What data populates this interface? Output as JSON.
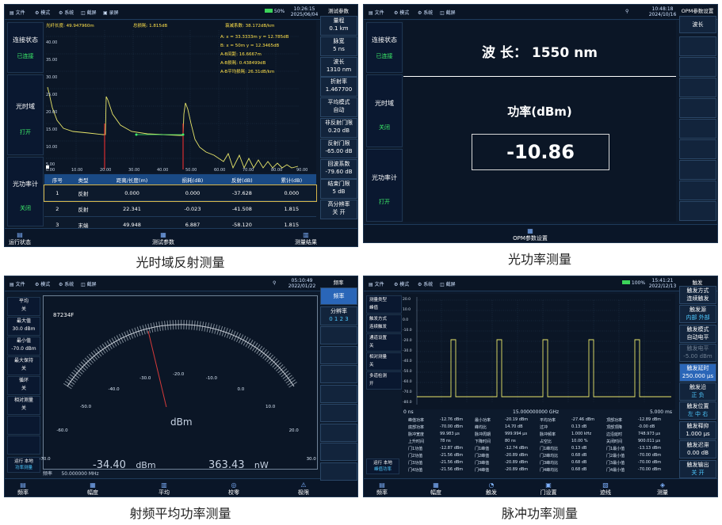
{
  "menu": {
    "file": "文件",
    "mode": "模式",
    "system": "系统",
    "screenshot": "截屏",
    "record": "录屏"
  },
  "otdr": {
    "battery": "50%",
    "time": "10:26:15",
    "date": "2025/06/04",
    "left": {
      "conn_label": "连接状态",
      "conn_value": "已连接",
      "otdr_label": "光时域",
      "otdr_value": "打开",
      "opm_label": "光功率计",
      "opm_value": "关闭"
    },
    "header": {
      "fiber_length": "光纤长度: 49.947960m",
      "total_loss": "总损耗: 1.815dB",
      "attenuation": "衰减系数: 38.172dB/km"
    },
    "markers": [
      "A:  x = 33.3333m    y = 12.785dB",
      "B:  x = 50m      y = 12.3465dB",
      "A-B间距:     16.6667m",
      "A-B损耗:     0.438499dB",
      "A-B平均损耗:    26.31dB/km"
    ],
    "y_ticks": [
      "40.00",
      "35.00",
      "30.00",
      "25.00",
      "20.00",
      "15.00",
      "10.00",
      "5.00",
      "0.00"
    ],
    "x_ticks": [
      "0.00",
      "10.00",
      "20.00",
      "30.00",
      "40.00",
      "50.00",
      "60.00",
      "70.00",
      "80.00",
      "90.00"
    ],
    "table": {
      "headers": [
        "序号",
        "类型",
        "距离/长度(m)",
        "损耗(dB)",
        "反射(dB)",
        "累计(dB)"
      ],
      "rows": [
        [
          "1",
          "反射",
          "0.000",
          "0.000",
          "-37.628",
          "0.000"
        ],
        [
          "2",
          "反射",
          "22.341",
          "-0.023",
          "-41.508",
          "1.815"
        ],
        [
          "3",
          "末端",
          "49.948",
          "6.887",
          "-58.120",
          "1.815"
        ]
      ]
    },
    "right_title": "测试参数",
    "params": [
      {
        "label": "量程",
        "value": "0.1 km"
      },
      {
        "label": "脉宽",
        "value": "5 ns"
      },
      {
        "label": "波长",
        "value": "1310 nm"
      },
      {
        "label": "折射率",
        "value": "1.467700"
      },
      {
        "label": "平均模式",
        "value": "自动"
      },
      {
        "label": "非反射门限",
        "value": "0.20 dB"
      },
      {
        "label": "反射门限",
        "value": "-65.00 dB"
      },
      {
        "label": "回波系数",
        "value": "-79.60 dB"
      },
      {
        "label": "结束门限",
        "value": "5 dB"
      },
      {
        "label": "高分辨率",
        "value": "关    开"
      }
    ],
    "bottom": [
      "运行状态",
      "测试参数",
      "测量结果"
    ]
  },
  "opm": {
    "time": "10:48:18",
    "date": "2024/10/16",
    "right_title": "OPM参数设置",
    "right_btn": "波长",
    "left": {
      "conn_label": "连接状态",
      "conn_value": "已连接",
      "otdr_label": "光时域",
      "otdr_value": "关闭",
      "opm_label": "光功率计",
      "opm_value": "打开"
    },
    "wavelength": "波 长：   1550 nm",
    "power_label": "功率(dBm)",
    "power_value": "-10.86",
    "bottom": "OPM参数设置"
  },
  "rf": {
    "time": "05:10:49",
    "date": "2022/01/22",
    "right_title": "频率",
    "right_btn1": "频率",
    "res_label": "分辨率",
    "res_values": "0  1  2  3",
    "left": [
      {
        "label": "平均",
        "value": "关"
      },
      {
        "label": "最大值",
        "value": "30.0 dBm"
      },
      {
        "label": "最小值",
        "value": "-70.0 dBm"
      },
      {
        "label": "最大保持",
        "value": "关"
      },
      {
        "label": "循环",
        "value": "关"
      },
      {
        "label": "相对测量",
        "value": "关"
      }
    ],
    "status": "运行 本地",
    "status2": "功率测量",
    "model": "87234F",
    "scale": [
      "-70.0",
      "-60.0",
      "-50.0",
      "-40.0",
      "-30.0",
      "-20.0",
      "-10.0",
      "0.0",
      "10.0",
      "20.0",
      "30.0"
    ],
    "unit": "dBm",
    "reading1": "-34.40",
    "unit1": "dBm",
    "reading2": "363.43",
    "unit2": "nW",
    "freq_label": "频率",
    "freq_value": "50.000000 MHz",
    "bottom": [
      "频率",
      "幅度",
      "平均",
      "校零",
      "极限"
    ]
  },
  "pulse": {
    "battery": "100%",
    "time": "15:41:21",
    "date": "2022/12/13",
    "right_title": "触发",
    "left": [
      {
        "label": "测量类型",
        "value": "峰值"
      },
      {
        "label": "触发方式",
        "value": "连续触发"
      },
      {
        "label": "通道设置",
        "value": "关"
      },
      {
        "label": "相对测量",
        "value": "关"
      },
      {
        "label": "多道检测",
        "value": "开"
      }
    ],
    "status": "运行 本地",
    "status2": "峰值功率",
    "y_ticks": [
      "20.0",
      "10.0",
      "0.0",
      "-10.0",
      "-20.0",
      "-30.0",
      "-40.0",
      "-50.0",
      "-60.0",
      "-70.0",
      "-80.0"
    ],
    "x_left": "0 ns",
    "x_center": "15.000000000 GHz",
    "x_right": "5.000 ms",
    "table": [
      [
        "峰值功率",
        "-12.76 dBm",
        "最小功率",
        "-20.19 dBm",
        "平均功率",
        "-27.46 dBm",
        "顶部功率",
        "-12.89 dBm"
      ],
      [
        "底部功率",
        "-70.00 dBm",
        "峰均比",
        "14.70 dB",
        "过冲",
        "0.13 dB",
        "顶部顶降",
        "-0.00 dB"
      ],
      [
        "脉冲宽度",
        "99.983 μs",
        "脉冲周期",
        "999.994 μs",
        "脉冲频率",
        "1.000 kHz",
        "边沿延时",
        "748.973 μs"
      ],
      [
        "上升时间",
        "78 ns",
        "下降时间",
        "80 ns",
        "占空比",
        "10.00 %",
        "关闭时间",
        "900.011 μs"
      ],
      [
        "门1功值",
        "-12.87 dBm",
        "门1峰值",
        "-12.74 dBm",
        "门1峰均比",
        "0.13 dB",
        "门1最小值",
        "-13.13 dBm"
      ],
      [
        "门2功值",
        "-21.56 dBm",
        "门2峰值",
        "-20.89 dBm",
        "门2峰均比",
        "0.68 dB",
        "门2最小值",
        "-70.00 dBm"
      ],
      [
        "门3功值",
        "-21.56 dBm",
        "门3峰值",
        "-20.89 dBm",
        "门3峰均比",
        "0.68 dB",
        "门3最小值",
        "-70.00 dBm"
      ],
      [
        "门4功值",
        "-21.56 dBm",
        "门4峰值",
        "-20.89 dBm",
        "门4峰均比",
        "0.68 dB",
        "门4最小值",
        "-70.00 dBm"
      ]
    ],
    "params": [
      {
        "label": "触发方式",
        "value": "连续触发"
      },
      {
        "label": "触发源",
        "value": "内部  外部"
      },
      {
        "label": "触发模式",
        "value": "自动电平"
      },
      {
        "label": "触发电平",
        "value": "-5.00 dBm"
      },
      {
        "label": "触发延时",
        "value": "250.000 μs"
      },
      {
        "label": "触发沿",
        "value": "正    负"
      },
      {
        "label": "触发位置",
        "value": "左  中  右"
      },
      {
        "label": "触发释抑",
        "value": "1.000 μs"
      },
      {
        "label": "触发迟滞",
        "value": "0.00 dB"
      },
      {
        "label": "触发输出",
        "value": "关    开"
      }
    ],
    "bottom": [
      "频率",
      "幅度",
      "触发",
      "门设置",
      "迹线",
      "测量"
    ]
  },
  "captions": {
    "otdr": "光时域反射测量",
    "opm": "光功率测量",
    "rf": "射频平均功率测量",
    "pulse": "脉冲功率测量"
  }
}
